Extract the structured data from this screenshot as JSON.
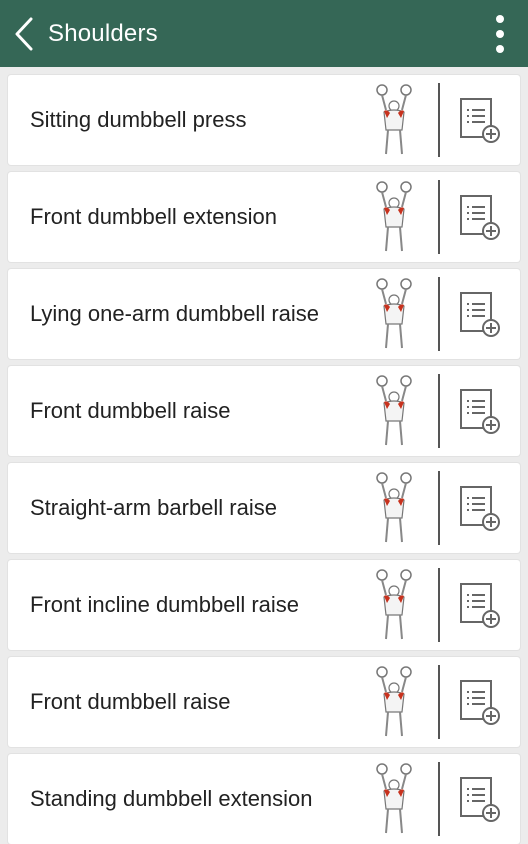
{
  "header": {
    "title": "Shoulders",
    "background": "#356756"
  },
  "exercises": [
    {
      "name": "Sitting dumbbell press",
      "illustration": "seated-overhead-press-figure"
    },
    {
      "name": "Front dumbbell extension",
      "illustration": "standing-lateral-figure"
    },
    {
      "name": "Lying one-arm dumbbell raise",
      "illustration": "lying-bench-raise-figure"
    },
    {
      "name": "Front dumbbell raise",
      "illustration": "standing-front-raise-figure"
    },
    {
      "name": "Straight-arm barbell raise",
      "illustration": "barbell-raise-figure"
    },
    {
      "name": "Front incline dumbbell raise",
      "illustration": "incline-bench-figure"
    },
    {
      "name": "Front dumbbell raise",
      "illustration": "standing-front-raise-figure"
    },
    {
      "name": "Standing dumbbell extension",
      "illustration": "standing-lateral-figure"
    }
  ],
  "icons": {
    "back": "chevron-left-icon",
    "menu": "more-vertical-icon",
    "add": "add-to-list-icon"
  },
  "colors": {
    "accent_muscle": "#c8321e"
  }
}
